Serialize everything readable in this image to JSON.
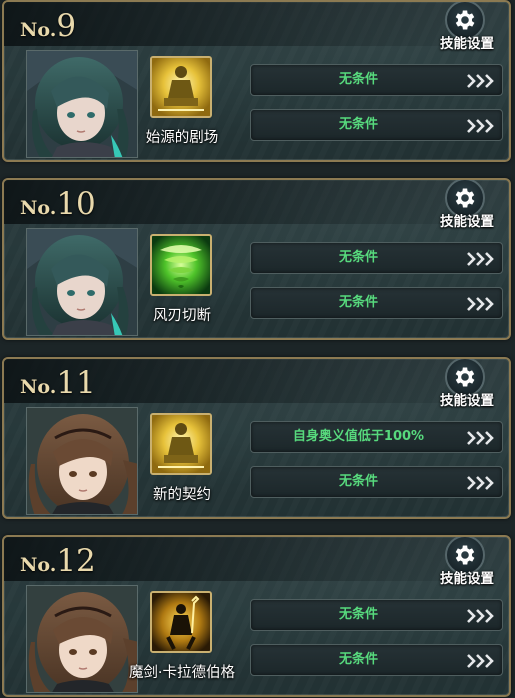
{
  "gear_label": "技能设置",
  "colors": {
    "condition_text": "#57d97d",
    "number_gold": "#e9d9ac",
    "frame_gold": "#8c7a52"
  },
  "slots": [
    {
      "prefix": "No.",
      "number": "9",
      "portrait": "green-haired-character-portrait",
      "skill_icon": "golden-statue-skill-icon",
      "skill_name": "始源的剧场",
      "conditions": [
        "无条件",
        "无条件"
      ]
    },
    {
      "prefix": "No.",
      "number": "10",
      "portrait": "green-haired-character-portrait",
      "skill_icon": "green-whirlwind-skill-icon",
      "skill_name": "风刃切断",
      "conditions": [
        "无条件",
        "无条件"
      ]
    },
    {
      "prefix": "No.",
      "number": "11",
      "portrait": "brown-haired-character-portrait",
      "skill_icon": "golden-statue-skill-icon",
      "skill_name": "新的契约",
      "conditions": [
        "自身奥义值低于100%",
        "无条件"
      ]
    },
    {
      "prefix": "No.",
      "number": "12",
      "portrait": "brown-haired-character-portrait",
      "skill_icon": "dark-knight-skill-icon",
      "skill_name": "魔剑·卡拉德伯格",
      "conditions": [
        "无条件",
        "无条件"
      ]
    }
  ]
}
